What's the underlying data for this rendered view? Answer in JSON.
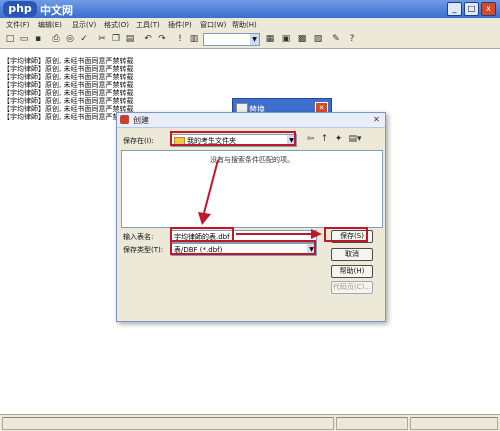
{
  "app": {
    "logo": "php",
    "name": "中文网",
    "close_glyph": "x"
  },
  "menu": [
    "文件(F)",
    "编辑(E)",
    "显示(V)",
    "格式(O)",
    "工具(T)",
    "插件(P)",
    "窗口(W)",
    "帮助(H)"
  ],
  "editor_lines": [
    "【宇均律師】原创, 未经书面同意严禁转载",
    "【宇均律師】原创, 未经书面同意严禁转载",
    "【宇均律師】原创, 未经书面同意严禁转载",
    "【宇均律師】原创, 未经书面同意严禁转载",
    "【宇均律師】原创, 未经书面同意严禁转载",
    "【宇均律師】原创, 未经书面同意严禁转载",
    "【宇均律師】原创, 未经书面同意严禁转载",
    "【宇均律師】原创, 未经书面同意严禁转载"
  ],
  "bg_dialog": {
    "title": "替换"
  },
  "save_dialog": {
    "title": "创建",
    "save_in_label": "保存在(I):",
    "folder": "我的考生文件夹",
    "empty_message": "没有与搜索条件匹配的项。",
    "filename_label": "输入表名:",
    "filename_value": "宇均律師的表.dbf",
    "filetype_label": "保存类型(T):",
    "filetype_value": "表/DBF (*.dbf)",
    "buttons": {
      "save": "保存(S)",
      "cancel": "取消",
      "help": "帮助(H)",
      "code_page": "代码页(C)..."
    }
  },
  "colors": {
    "annotation": "#c0182b",
    "title_blue": "#3b6fd0",
    "dialog_bg": "#ece9d8"
  }
}
